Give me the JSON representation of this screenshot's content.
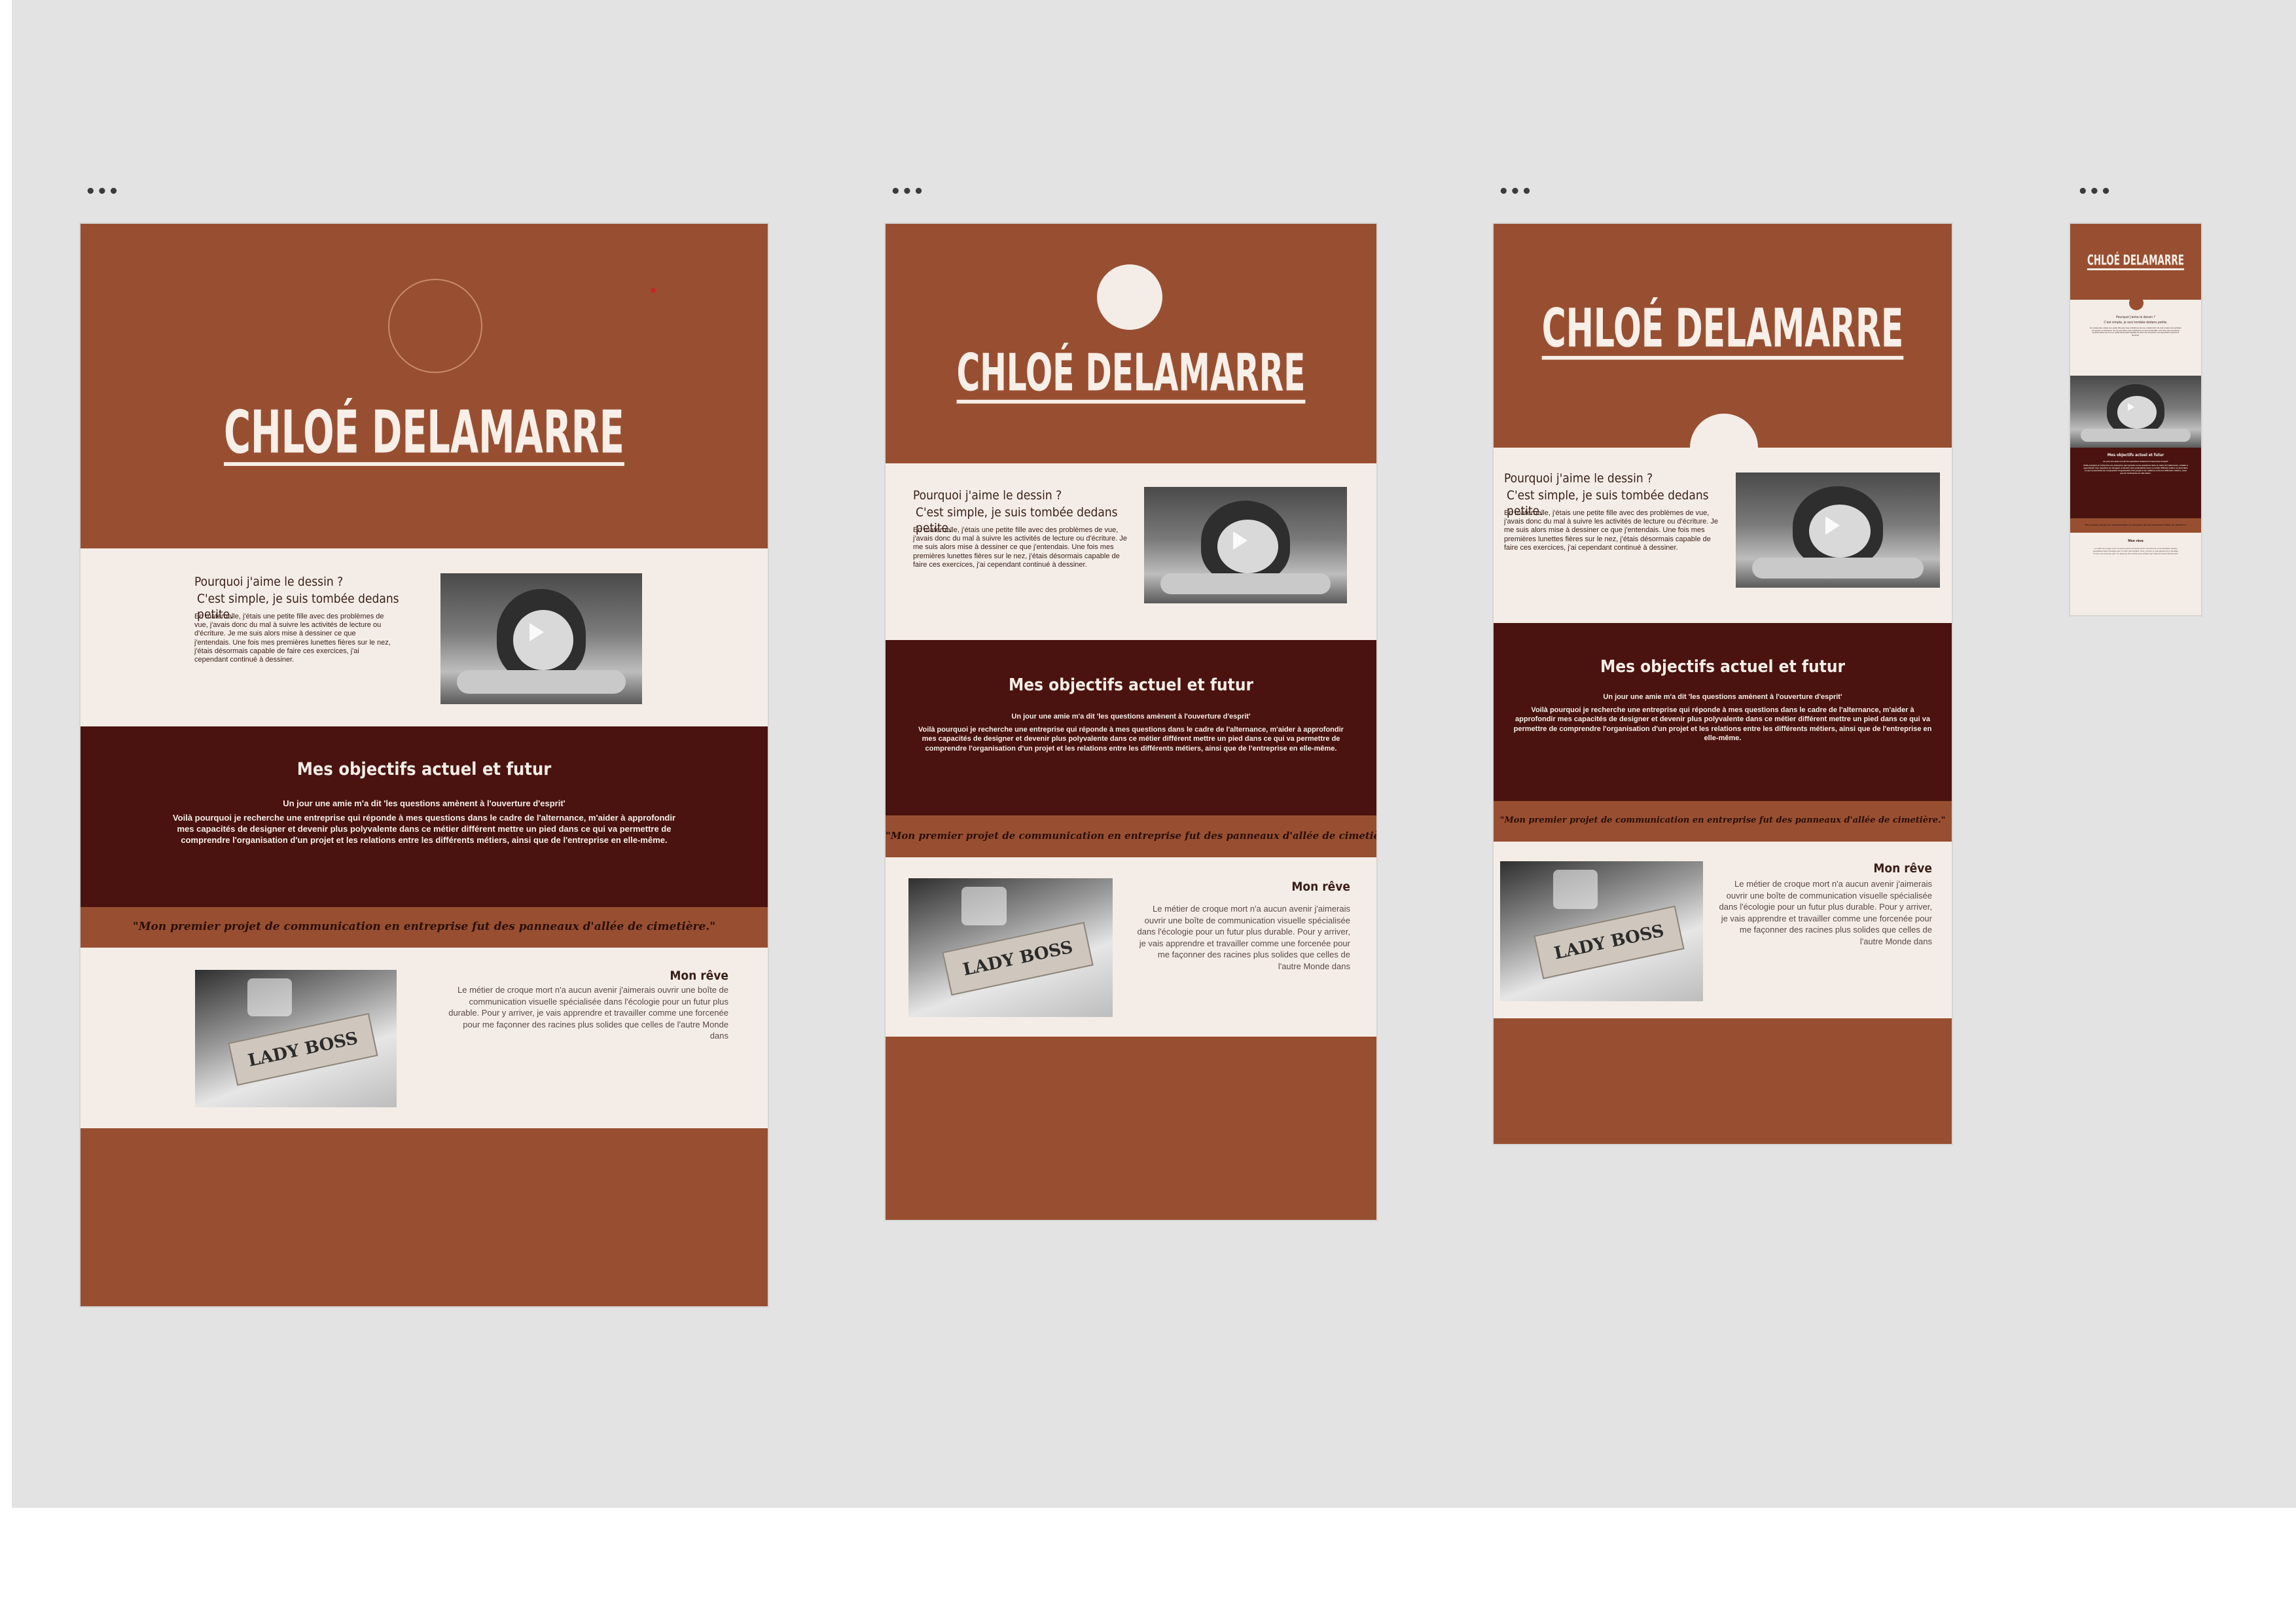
{
  "frames": {
    "handle": "•••",
    "name": "CHLOÉ DELAMARRE",
    "question_line1": "Pourquoi j'aime le dessin ?",
    "question_line2": "C'est simple, je suis tombée dedans petite.",
    "body_text": "En maternelle, j'étais une petite fille avec des problèmes de vue, j'avais donc du mal à suivre les activités de lecture ou d'écriture. Je me suis alors mise à dessiner ce que j'entendais. Une fois mes premières lunettes fières sur le nez, j'étais désormais capable de faire ces exercices, j'ai cependant continué à dessiner.",
    "objectives_title": "Mes objectifs actuel et futur",
    "objectives_text_1": "Un jour une amie m'a dit 'les questions amènent à l'ouverture d'esprit'",
    "objectives_text_2": "Voilà pourquoi je recherche une entreprise qui réponde à mes questions dans le cadre de l'alternance, m'aider à approfondir mes capacités de designer et devenir plus polyvalente dans ce métier différent mettre un pied dans ce qui va permettre de comprendre l'organisation d'un projet et les relations entre les différents métiers, ainsi que de l'entreprise en elle-même.",
    "quote": "\"Mon premier projet de communication en entreprise fut des panneaux d'allée de cimetière.\"",
    "reve_title": "Mon rêve",
    "reve_text": "Le métier de croque mort n'a aucun avenir j'aimerais ouvrir une boîte de communication visuelle spécialisée dans l'écologie pour un futur plus durable. Pour y arriver, je vais apprendre et travailler comme une forcenée pour me façonner des racines plus solides que celles de l'autre Monde dans",
    "lady_boss": "LADY BOSS"
  }
}
